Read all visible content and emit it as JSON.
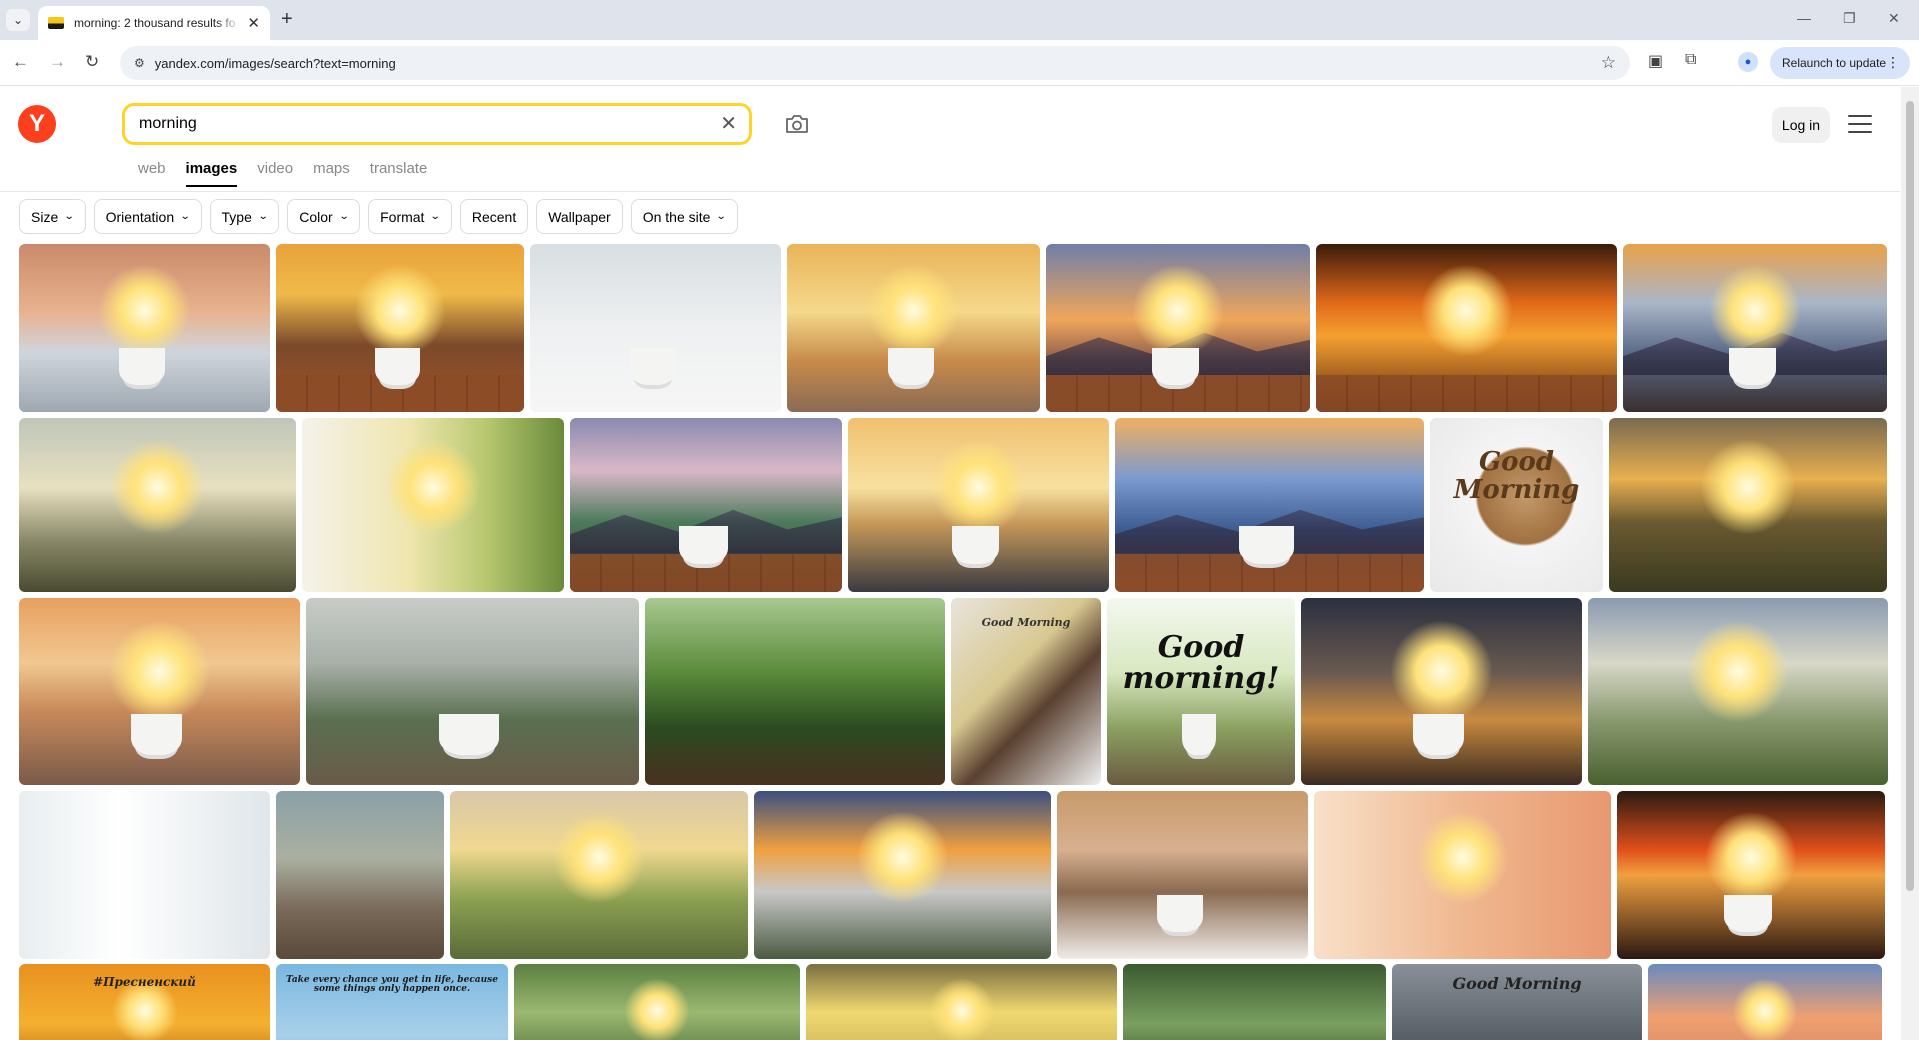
{
  "browser": {
    "tab_title": "morning: 2 thousand results fo",
    "url": "yandex.com/images/search?text=morning",
    "relaunch_label": "Relaunch to update",
    "icons": [
      "tab-dropdown-icon",
      "new-tab-icon",
      "minimize-icon",
      "restore-icon",
      "close-window-icon",
      "back-icon",
      "forward-icon",
      "reload-icon",
      "site-info-icon",
      "bookmark-star-icon",
      "cast-icon",
      "extensions-icon",
      "profile-icon",
      "more-icon"
    ]
  },
  "header": {
    "logo_letter": "Y",
    "search_value": "morning",
    "login_label": "Log in",
    "tabs": [
      {
        "label": "web",
        "active": false
      },
      {
        "label": "images",
        "active": true
      },
      {
        "label": "video",
        "active": false
      },
      {
        "label": "maps",
        "active": false
      },
      {
        "label": "translate",
        "active": false
      }
    ]
  },
  "filters": [
    {
      "label": "Size",
      "dropdown": true
    },
    {
      "label": "Orientation",
      "dropdown": true
    },
    {
      "label": "Type",
      "dropdown": true
    },
    {
      "label": "Color",
      "dropdown": true
    },
    {
      "label": "Format",
      "dropdown": true
    },
    {
      "label": "Recent",
      "dropdown": false
    },
    {
      "label": "Wallpaper",
      "dropdown": false
    },
    {
      "label": "On the site",
      "dropdown": true
    }
  ],
  "image_rows": [
    [
      {
        "name": "coffee-mug-railing-sunrise",
        "bg": "linear-gradient(180deg,#c98a6a 0%,#e8b28e 40%,#cfd5dc 65%,#9ea7b0 100%)",
        "sun": true,
        "cup": true
      },
      {
        "name": "mug-mountain-sunset",
        "bg": "linear-gradient(180deg,#e8a33a 0%,#f0b94a 30%,#7a4a2a 60%,#a5532a 100%)",
        "sun": true,
        "cup": true,
        "table": true
      },
      {
        "name": "coffee-cookies-window",
        "bg": "linear-gradient(180deg,#d8dee2 0%,#eef0f1 50%,#f6f6f6 100%)",
        "cup": true
      },
      {
        "name": "cup-lake-sunrise",
        "bg": "linear-gradient(180deg,#e9b35a 0%,#f5d98a 40%,#c78a4a 70%,#8a6a55 100%)",
        "sun": true,
        "cup": true
      },
      {
        "name": "cup-table-sunset-hills",
        "bg": "linear-gradient(180deg,#6f7fa8 0%,#f0a65a 45%,#8a5a4a 70%,#7a4a30 100%)",
        "sun": true,
        "cup": true,
        "table": true,
        "hills": true
      },
      {
        "name": "dark-mug-fiery-sky",
        "bg": "linear-gradient(180deg,#3a1a0a 0%,#e06a1a 35%,#f5a030 55%,#5a2a10 100%)",
        "sun": true,
        "table": true
      },
      {
        "name": "mountains-coffee-earphones",
        "bg": "linear-gradient(180deg,#e9a24a 0%,#aab6c8 35%,#5a6a88 65%,#3a3030 100%)",
        "sun": true,
        "cup": true,
        "hills": true
      }
    ],
    [
      {
        "name": "tree-misty-sunrise",
        "bg": "linear-gradient(180deg,#bfc6b8 0%,#e8e0c0 40%,#8a8a6a 70%,#4a4a30 100%)",
        "sun": true
      },
      {
        "name": "yellow-cup-window",
        "bg": "linear-gradient(90deg,#f4f2ea 0%,#f0e6b0 40%,#b8c870 70%,#6a8a3a 100%)",
        "sun": true
      },
      {
        "name": "coffee-notebook-mountains",
        "bg": "linear-gradient(180deg,#8a8ab0 0%,#d9b8c8 30%,#4a7a5a 60%,#5a3a28 100%)",
        "cup": true,
        "hills": true,
        "table": true
      },
      {
        "name": "coffee-lake-pen",
        "bg": "linear-gradient(180deg,#f0c070 0%,#f8e0a0 40%,#c89a5a 60%,#3a3a40 100%)",
        "sun": true,
        "cup": true
      },
      {
        "name": "coffee-blue-mountains",
        "bg": "linear-gradient(180deg,#f0b060 0%,#7a9ad0 35%,#3a5a90 65%,#a0502a 100%)",
        "cup": true,
        "hills": true,
        "table": true
      },
      {
        "name": "good-morning-latte",
        "bg": "radial-gradient(circle at 55% 45%,#c49a6a 0%,#a07040 35%,#f4f4f4 37%,#e8e8e8 100%)",
        "caption": "Good Morning",
        "caption_color": "#5a3a1a",
        "caption_size": 26
      },
      {
        "name": "field-golden-sunset",
        "bg": "linear-gradient(180deg,#7a6a50 0%,#e8b050 35%,#6a5a30 60%,#3a3a20 100%)",
        "sun": true
      }
    ],
    [
      {
        "name": "yoga-beach-coffee",
        "bg": "linear-gradient(180deg,#e8a060 0%,#f0c890 35%,#c88a5a 60%,#7a5a4a 100%)",
        "sun": true,
        "cup": true
      },
      {
        "name": "white-mug-forest-fog",
        "bg": "linear-gradient(180deg,#c8ccc8 0%,#a8b0a8 35%,#5a7050 65%,#6a5a48 100%)",
        "cup": true
      },
      {
        "name": "red-mug-muffin-garden",
        "bg": "linear-gradient(180deg,#a8c890 0%,#5a8a3a 40%,#2a4a20 70%,#4a3020 100%)"
      },
      {
        "name": "good-morning-card-knit",
        "bg": "linear-gradient(135deg,#e8e4dc 0%,#d8c890 40%,#5a4030 60%,#f0f0f0 100%)",
        "caption": "Good Morning",
        "caption_color": "#333",
        "caption_size": 11
      },
      {
        "name": "good-morning-text-cup",
        "bg": "linear-gradient(180deg,#f4f8f0 0%,#d8e8c0 40%,#8aa060 70%,#6a5a40 100%)",
        "caption": "Good morning!",
        "caption_color": "#111",
        "caption_size": 30,
        "cup": true
      },
      {
        "name": "steaming-cup-sunlight",
        "bg": "linear-gradient(180deg,#2a3040 0%,#6a5a50 40%,#c88a40 65%,#3a2a20 100%)",
        "sun": true,
        "cup": true
      },
      {
        "name": "sunrise-meadow-rays",
        "bg": "linear-gradient(180deg,#8a9ab0 0%,#d8d8c8 35%,#8a9a70 65%,#4a6030 100%)",
        "sun": true
      }
    ],
    [
      {
        "name": "woman-stretching-bedroom",
        "bg": "linear-gradient(90deg,#e8eef0 0%,#ffffff 40%,#e0e6ea 100%)"
      },
      {
        "name": "coffee-pink-flowers-lake",
        "bg": "linear-gradient(180deg,#8aa0a8 0%,#aab0a0 40%,#7a6a5a 70%,#5a4a3a 100%)"
      },
      {
        "name": "lone-tree-path-sunset",
        "bg": "linear-gradient(180deg,#d8c8a8 0%,#f0d890 35%,#8aa050 65%,#5a6a3a 100%)",
        "sun": true
      },
      {
        "name": "mount-fog-valley-sunrise",
        "bg": "linear-gradient(180deg,#3a5080 0%,#f0a040 35%,#c8c8c8 60%,#4a5a40 100%)",
        "sun": true
      },
      {
        "name": "coffee-croissant-city",
        "bg": "linear-gradient(180deg,#c89a6a 0%,#d8b090 35%,#8a6a50 60%,#f0ece8 100%)",
        "cup": true
      },
      {
        "name": "woman-waking-bed",
        "bg": "linear-gradient(90deg,#f8e0c8 0%,#f0b890 50%,#e89870 100%)",
        "sun": true
      },
      {
        "name": "cup-beans-red-sunset",
        "bg": "linear-gradient(180deg,#2a1a10 0%,#e0501a 35%,#f0a040 50%,#2a1810 100%)",
        "sun": true,
        "cup": true
      }
    ],
    [
      {
        "name": "mug-sunset-hashtag",
        "bg": "linear-gradient(180deg,#e89020 0%,#f5b030 50%,#a05010 100%)",
        "sun": true,
        "caption": "#Пресненский",
        "caption_color": "#222",
        "caption_size": 12
      },
      {
        "name": "quote-purple-flowers",
        "bg": "linear-gradient(180deg,#7ab8e0 0%,#a8d0ea 60%,#6a8ab0 100%)",
        "caption": "Take every chance you get in life, because some things only happen once.",
        "caption_color": "#1a1a1a",
        "caption_size": 9
      },
      {
        "name": "forest-light-chair",
        "bg": "linear-gradient(180deg,#5a8040 0%,#9ab870 40%,#3a5a2a 100%)",
        "sun": true
      },
      {
        "name": "golden-lake-sunrise",
        "bg": "linear-gradient(180deg,#7a7040 0%,#f0d870 40%,#b8a050 100%)",
        "sun": true
      },
      {
        "name": "green-bokeh-heart",
        "bg": "linear-gradient(180deg,#3a5a30 0%,#7aa060 50%,#2a4020 100%)"
      },
      {
        "name": "good-morning-dark-sky",
        "bg": "linear-gradient(180deg,#8a9098 0%,#5a6068 60%,#3a3a3a 100%)",
        "caption": "Good Morning",
        "caption_color": "#222",
        "caption_size": 16
      },
      {
        "name": "sunrise-clouds-field",
        "bg": "linear-gradient(180deg,#6a8ac0 0%,#f0a070 45%,#c88060 100%)",
        "sun": true
      }
    ]
  ]
}
